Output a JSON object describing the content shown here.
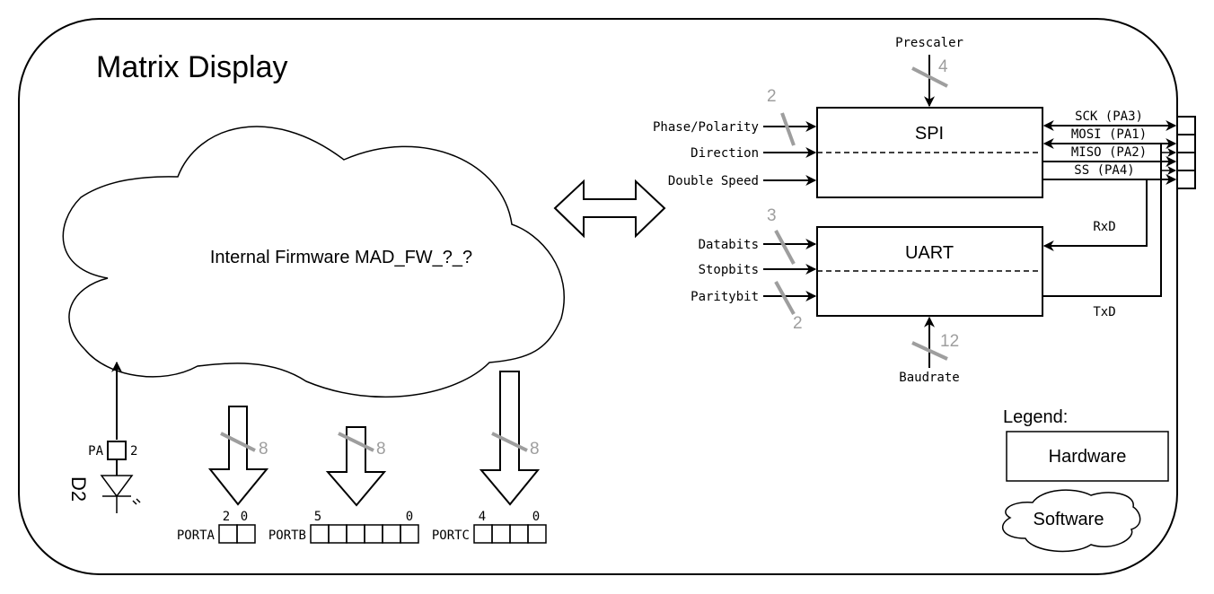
{
  "title": "Matrix Display",
  "firmware": {
    "label": "Internal Firmware MAD_FW_?_?"
  },
  "spi": {
    "label": "SPI",
    "top_input": {
      "label": "Prescaler",
      "width": "4"
    },
    "inputs": [
      {
        "label": "Phase/Polarity",
        "width": "2"
      },
      {
        "label": "Direction"
      },
      {
        "label": "Double Speed"
      }
    ],
    "pins": [
      {
        "label": "SCK (PA3)",
        "direction": "bidirectional"
      },
      {
        "label": "MOSI (PA1)",
        "direction": "bidirectional"
      },
      {
        "label": "MISO (PA2)",
        "direction": "out"
      },
      {
        "label": "SS (PA4)",
        "direction": "out"
      }
    ]
  },
  "uart": {
    "label": "UART",
    "inputs": [
      {
        "label": "Databits",
        "width": "3"
      },
      {
        "label": "Stopbits"
      },
      {
        "label": "Paritybit",
        "width": "2"
      }
    ],
    "bottom_input": {
      "label": "Baudrate",
      "width": "12"
    },
    "rx_label": "RxD",
    "tx_label": "TxD"
  },
  "led": {
    "pin_prefix": "PA",
    "pin_number": "2",
    "designator": "D2"
  },
  "ports": [
    {
      "name": "PORTA",
      "bus_width": "8",
      "msb": "2",
      "lsb": "0",
      "bits": 2
    },
    {
      "name": "PORTB",
      "bus_width": "8",
      "msb": "5",
      "lsb": "0",
      "bits": 6
    },
    {
      "name": "PORTC",
      "bus_width": "8",
      "msb": "4",
      "lsb": "0",
      "bits": 4
    }
  ],
  "legend": {
    "title": "Legend:",
    "hardware_label": "Hardware",
    "software_label": "Software"
  }
}
